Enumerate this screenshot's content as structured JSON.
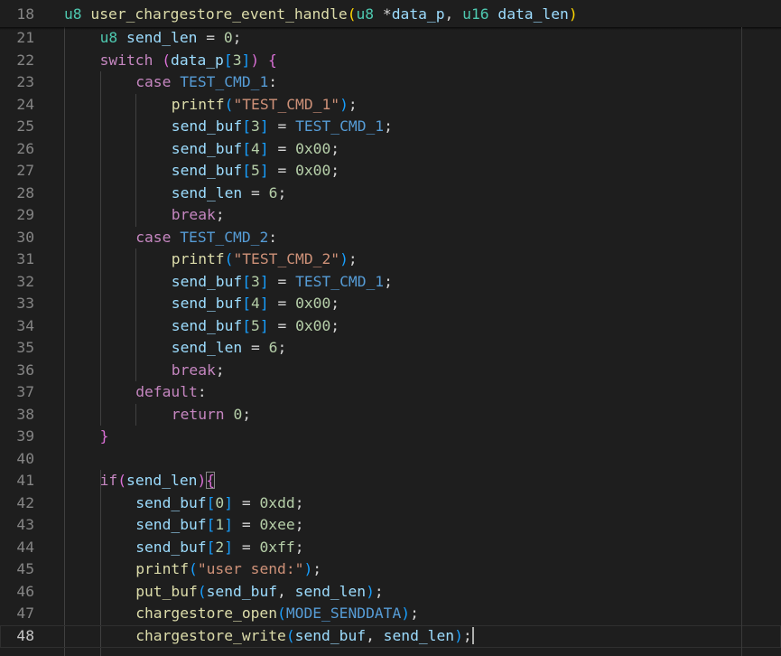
{
  "editor": {
    "current_line": "48",
    "lines": [
      {
        "num": "18",
        "tokens": [
          {
            "t": "u8",
            "c": "ty"
          },
          {
            "t": " "
          },
          {
            "t": "user_chargestore_event_handle",
            "c": "fn"
          },
          {
            "t": "(",
            "c": "b1"
          },
          {
            "t": "u8",
            "c": "ty"
          },
          {
            "t": " *"
          },
          {
            "t": "data_p",
            "c": "pr"
          },
          {
            "t": ", "
          },
          {
            "t": "u16",
            "c": "ty"
          },
          {
            "t": " "
          },
          {
            "t": "data_len",
            "c": "pr"
          },
          {
            "t": ")",
            "c": "b1"
          }
        ]
      },
      {
        "num": "21",
        "tokens": [
          {
            "t": "u8",
            "c": "ty"
          },
          {
            "t": " "
          },
          {
            "t": "send_len",
            "c": "pr"
          },
          {
            "t": " = "
          },
          {
            "t": "0",
            "c": "nu"
          },
          {
            "t": ";"
          }
        ]
      },
      {
        "num": "22",
        "tokens": [
          {
            "t": "switch",
            "c": "cl"
          },
          {
            "t": " "
          },
          {
            "t": "(",
            "c": "b2"
          },
          {
            "t": "data_p",
            "c": "pr"
          },
          {
            "t": "[",
            "c": "b3"
          },
          {
            "t": "3",
            "c": "nu"
          },
          {
            "t": "]",
            "c": "b3"
          },
          {
            "t": ")",
            "c": "b2"
          },
          {
            "t": " "
          },
          {
            "t": "{",
            "c": "b2"
          }
        ]
      },
      {
        "num": "23",
        "tokens": [
          {
            "t": "case",
            "c": "cl"
          },
          {
            "t": " "
          },
          {
            "t": "TEST_CMD_1",
            "c": "ma"
          },
          {
            "t": ":"
          }
        ]
      },
      {
        "num": "24",
        "tokens": [
          {
            "t": "printf",
            "c": "fn"
          },
          {
            "t": "(",
            "c": "b3"
          },
          {
            "t": "\"TEST_CMD_1\"",
            "c": "st"
          },
          {
            "t": ")",
            "c": "b3"
          },
          {
            "t": ";"
          }
        ]
      },
      {
        "num": "25",
        "tokens": [
          {
            "t": "send_buf",
            "c": "pr"
          },
          {
            "t": "[",
            "c": "b3"
          },
          {
            "t": "3",
            "c": "nu"
          },
          {
            "t": "]",
            "c": "b3"
          },
          {
            "t": " = "
          },
          {
            "t": "TEST_CMD_1",
            "c": "ma"
          },
          {
            "t": ";"
          }
        ]
      },
      {
        "num": "26",
        "tokens": [
          {
            "t": "send_buf",
            "c": "pr"
          },
          {
            "t": "[",
            "c": "b3"
          },
          {
            "t": "4",
            "c": "nu"
          },
          {
            "t": "]",
            "c": "b3"
          },
          {
            "t": " = "
          },
          {
            "t": "0x00",
            "c": "nu"
          },
          {
            "t": ";"
          }
        ]
      },
      {
        "num": "27",
        "tokens": [
          {
            "t": "send_buf",
            "c": "pr"
          },
          {
            "t": "[",
            "c": "b3"
          },
          {
            "t": "5",
            "c": "nu"
          },
          {
            "t": "]",
            "c": "b3"
          },
          {
            "t": " = "
          },
          {
            "t": "0x00",
            "c": "nu"
          },
          {
            "t": ";"
          }
        ]
      },
      {
        "num": "28",
        "tokens": [
          {
            "t": "send_len",
            "c": "pr"
          },
          {
            "t": " = "
          },
          {
            "t": "6",
            "c": "nu"
          },
          {
            "t": ";"
          }
        ]
      },
      {
        "num": "29",
        "tokens": [
          {
            "t": "break",
            "c": "cl"
          },
          {
            "t": ";"
          }
        ]
      },
      {
        "num": "30",
        "tokens": [
          {
            "t": "case",
            "c": "cl"
          },
          {
            "t": " "
          },
          {
            "t": "TEST_CMD_2",
            "c": "ma"
          },
          {
            "t": ":"
          }
        ]
      },
      {
        "num": "31",
        "tokens": [
          {
            "t": "printf",
            "c": "fn"
          },
          {
            "t": "(",
            "c": "b3"
          },
          {
            "t": "\"TEST_CMD_2\"",
            "c": "st"
          },
          {
            "t": ")",
            "c": "b3"
          },
          {
            "t": ";"
          }
        ]
      },
      {
        "num": "32",
        "tokens": [
          {
            "t": "send_buf",
            "c": "pr"
          },
          {
            "t": "[",
            "c": "b3"
          },
          {
            "t": "3",
            "c": "nu"
          },
          {
            "t": "]",
            "c": "b3"
          },
          {
            "t": " = "
          },
          {
            "t": "TEST_CMD_1",
            "c": "ma"
          },
          {
            "t": ";"
          }
        ]
      },
      {
        "num": "33",
        "tokens": [
          {
            "t": "send_buf",
            "c": "pr"
          },
          {
            "t": "[",
            "c": "b3"
          },
          {
            "t": "4",
            "c": "nu"
          },
          {
            "t": "]",
            "c": "b3"
          },
          {
            "t": " = "
          },
          {
            "t": "0x00",
            "c": "nu"
          },
          {
            "t": ";"
          }
        ]
      },
      {
        "num": "34",
        "tokens": [
          {
            "t": "send_buf",
            "c": "pr"
          },
          {
            "t": "[",
            "c": "b3"
          },
          {
            "t": "5",
            "c": "nu"
          },
          {
            "t": "]",
            "c": "b3"
          },
          {
            "t": " = "
          },
          {
            "t": "0x00",
            "c": "nu"
          },
          {
            "t": ";"
          }
        ]
      },
      {
        "num": "35",
        "tokens": [
          {
            "t": "send_len",
            "c": "pr"
          },
          {
            "t": " = "
          },
          {
            "t": "6",
            "c": "nu"
          },
          {
            "t": ";"
          }
        ]
      },
      {
        "num": "36",
        "tokens": [
          {
            "t": "break",
            "c": "cl"
          },
          {
            "t": ";"
          }
        ]
      },
      {
        "num": "37",
        "tokens": [
          {
            "t": "default",
            "c": "cl"
          },
          {
            "t": ":"
          }
        ]
      },
      {
        "num": "38",
        "tokens": [
          {
            "t": "return",
            "c": "cl"
          },
          {
            "t": " "
          },
          {
            "t": "0",
            "c": "nu"
          },
          {
            "t": ";"
          }
        ]
      },
      {
        "num": "39",
        "tokens": [
          {
            "t": "}",
            "c": "b2"
          }
        ]
      },
      {
        "num": "40",
        "tokens": []
      },
      {
        "num": "41",
        "tokens": [
          {
            "t": "if",
            "c": "cl"
          },
          {
            "t": "(",
            "c": "b2"
          },
          {
            "t": "send_len",
            "c": "pr"
          },
          {
            "t": ")",
            "c": "b2"
          },
          {
            "t": "{",
            "c": "b2",
            "box": true
          }
        ]
      },
      {
        "num": "42",
        "tokens": [
          {
            "t": "send_buf",
            "c": "pr"
          },
          {
            "t": "[",
            "c": "b3"
          },
          {
            "t": "0",
            "c": "nu"
          },
          {
            "t": "]",
            "c": "b3"
          },
          {
            "t": " = "
          },
          {
            "t": "0xdd",
            "c": "nu"
          },
          {
            "t": ";"
          }
        ]
      },
      {
        "num": "43",
        "tokens": [
          {
            "t": "send_buf",
            "c": "pr"
          },
          {
            "t": "[",
            "c": "b3"
          },
          {
            "t": "1",
            "c": "nu"
          },
          {
            "t": "]",
            "c": "b3"
          },
          {
            "t": " = "
          },
          {
            "t": "0xee",
            "c": "nu"
          },
          {
            "t": ";"
          }
        ]
      },
      {
        "num": "44",
        "tokens": [
          {
            "t": "send_buf",
            "c": "pr"
          },
          {
            "t": "[",
            "c": "b3"
          },
          {
            "t": "2",
            "c": "nu"
          },
          {
            "t": "]",
            "c": "b3"
          },
          {
            "t": " = "
          },
          {
            "t": "0xff",
            "c": "nu"
          },
          {
            "t": ";"
          }
        ]
      },
      {
        "num": "45",
        "tokens": [
          {
            "t": "printf",
            "c": "fn"
          },
          {
            "t": "(",
            "c": "b3"
          },
          {
            "t": "\"user send:\"",
            "c": "st"
          },
          {
            "t": ")",
            "c": "b3"
          },
          {
            "t": ";"
          }
        ]
      },
      {
        "num": "46",
        "tokens": [
          {
            "t": "put_buf",
            "c": "fn"
          },
          {
            "t": "(",
            "c": "b3"
          },
          {
            "t": "send_buf",
            "c": "pr"
          },
          {
            "t": ", "
          },
          {
            "t": "send_len",
            "c": "pr"
          },
          {
            "t": ")",
            "c": "b3"
          },
          {
            "t": ";"
          }
        ]
      },
      {
        "num": "47",
        "tokens": [
          {
            "t": "chargestore_open",
            "c": "fn"
          },
          {
            "t": "(",
            "c": "b3"
          },
          {
            "t": "MODE_SENDDATA",
            "c": "ma"
          },
          {
            "t": ")",
            "c": "b3"
          },
          {
            "t": ";"
          }
        ]
      },
      {
        "num": "48",
        "tokens": [
          {
            "t": "chargestore_write",
            "c": "fn"
          },
          {
            "t": "(",
            "c": "b3"
          },
          {
            "t": "send_buf",
            "c": "pr"
          },
          {
            "t": ", "
          },
          {
            "t": "send_len",
            "c": "pr"
          },
          {
            "t": ")",
            "c": "b3"
          },
          {
            "t": ";",
            "cursor": true
          }
        ]
      }
    ]
  }
}
